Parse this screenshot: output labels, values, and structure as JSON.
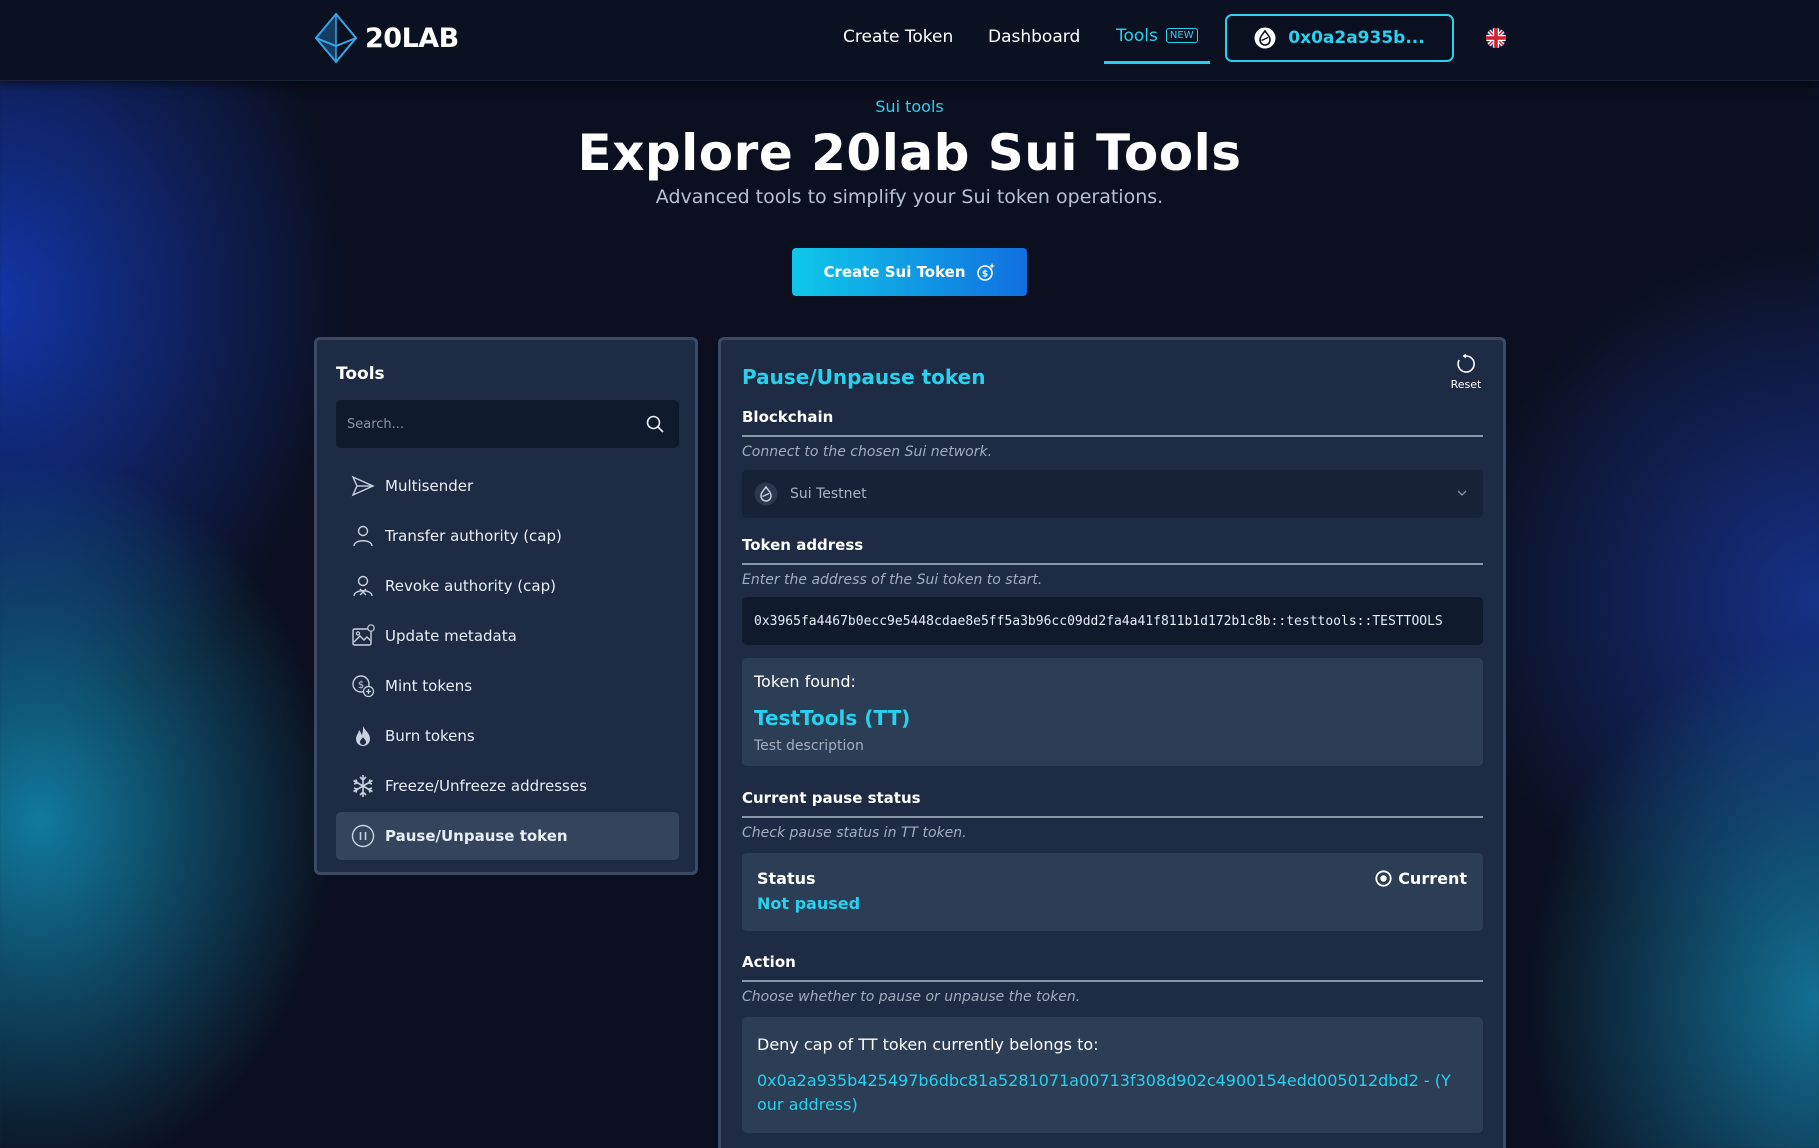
{
  "header": {
    "logo_text": "20LAB",
    "nav": {
      "create_token": "Create Token",
      "dashboard": "Dashboard",
      "tools": "Tools",
      "tools_badge": "NEW"
    },
    "wallet_address": "0x0a2a935b...",
    "language_icon": "uk-flag-icon"
  },
  "hero": {
    "eyebrow": "Sui tools",
    "title": "Explore 20lab Sui Tools",
    "subtitle": "Advanced tools to simplify your Sui token operations.",
    "cta_label": "Create Sui Token"
  },
  "sidebar": {
    "title": "Tools",
    "search_placeholder": "Search...",
    "items": [
      {
        "label": "Multisender",
        "icon": "send-icon"
      },
      {
        "label": "Transfer authority (cap)",
        "icon": "user-icon"
      },
      {
        "label": "Revoke authority (cap)",
        "icon": "user-x-icon"
      },
      {
        "label": "Update metadata",
        "icon": "image-edit-icon"
      },
      {
        "label": "Mint tokens",
        "icon": "coin-plus-icon"
      },
      {
        "label": "Burn tokens",
        "icon": "flame-icon"
      },
      {
        "label": "Freeze/Unfreeze addresses",
        "icon": "snowflake-icon"
      },
      {
        "label": "Pause/Unpause token",
        "icon": "pause-circle-icon",
        "active": true
      }
    ]
  },
  "panel": {
    "title": "Pause/Unpause token",
    "reset_label": "Reset",
    "blockchain": {
      "label": "Blockchain",
      "description": "Connect to the chosen Sui network.",
      "selected": "Sui Testnet"
    },
    "token_address": {
      "label": "Token address",
      "description": "Enter the address of the Sui token to start.",
      "value": "0x3965fa4467b0ecc9e5448cdae8e5ff5a3b96cc09dd2fa4a41f811b1d172b1c8b::testtools::TESTTOOLS"
    },
    "token_found": {
      "label": "Token found:",
      "name": "TestTools (TT)",
      "description": "Test description"
    },
    "pause_status": {
      "label": "Current pause status",
      "description": "Check pause status in TT token.",
      "status_label": "Status",
      "status_value": "Not paused",
      "current_label": "Current"
    },
    "action": {
      "label": "Action",
      "description": "Choose whether to pause or unpause the token.",
      "deny_cap_label": "Deny cap of TT token currently belongs to:",
      "deny_cap_owner": "0x0a2a935b425497b6dbc81a5281071a00713f308d902c4900154edd005012dbd2 - (Your address)"
    }
  },
  "colors": {
    "accent": "#27d2ee",
    "panel_bg": "#1d2b44",
    "card_bg": "#2c3d56",
    "page_bg": "#0b0f1f"
  }
}
